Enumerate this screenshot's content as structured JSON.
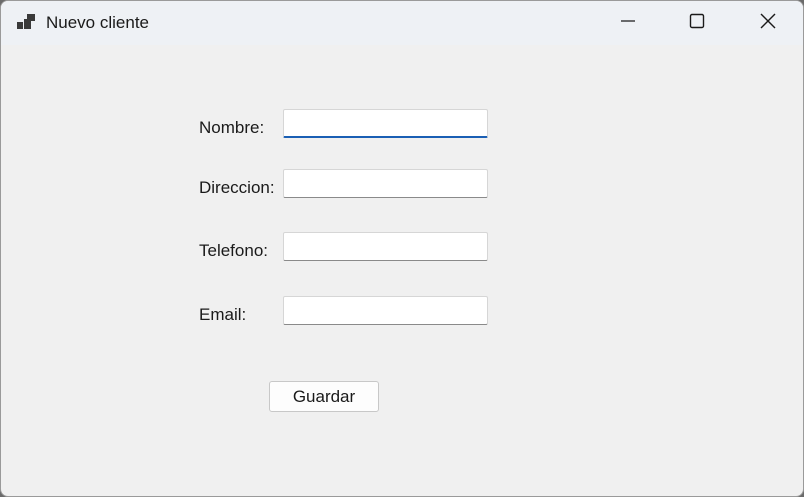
{
  "window": {
    "title": "Nuevo cliente",
    "icon": "app-window-icon",
    "controls": [
      "minimize-icon",
      "maximize-icon",
      "close-icon"
    ]
  },
  "form": {
    "fields": [
      {
        "label": "Nombre:",
        "value": "",
        "focused": true
      },
      {
        "label": "Direccion:",
        "value": ""
      },
      {
        "label": "Telefono:",
        "value": ""
      },
      {
        "label": "Email:",
        "value": ""
      }
    ],
    "submit_label": "Guardar"
  },
  "colors": {
    "focus_accent": "#1a5fb4",
    "background": "#f0f0f0"
  }
}
